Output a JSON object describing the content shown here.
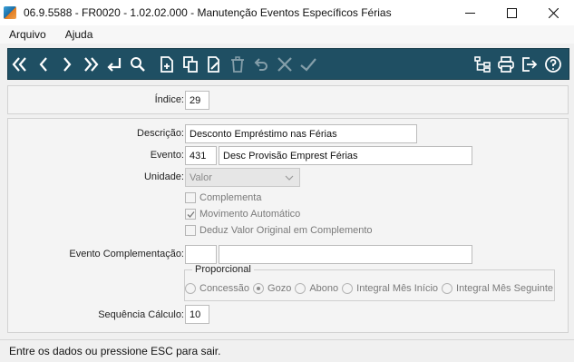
{
  "window": {
    "title": "06.9.5588 - FR0020 - 1.02.02.000 - Manutenção Eventos Específicos Férias"
  },
  "menu": {
    "items": [
      "Arquivo",
      "Ajuda"
    ]
  },
  "toolbar": {
    "icon_color": "#ffffff",
    "background": "#1f4f63",
    "buttons": [
      "first-record",
      "previous-record",
      "next-record",
      "last-record",
      "return",
      "search",
      "new-record",
      "copy-record",
      "edit-record",
      "delete-record",
      "undo",
      "cancel",
      "confirm",
      "tree",
      "print",
      "exit",
      "help"
    ]
  },
  "form": {
    "indice": {
      "label": "Índice:",
      "value": "29"
    },
    "descricao": {
      "label": "Descrição:",
      "value": "Desconto Empréstimo nas Férias"
    },
    "evento": {
      "label": "Evento:",
      "code": "431",
      "description": "Desc Provisão Emprest Férias"
    },
    "unidade": {
      "label": "Unidade:",
      "value": "Valor"
    },
    "checks": [
      {
        "label": "Complementa",
        "checked": false
      },
      {
        "label": "Movimento Automático",
        "checked": true
      },
      {
        "label": "Deduz Valor Original em Complemento",
        "checked": false
      }
    ],
    "evento_complementacao": {
      "label": "Evento Complementação:",
      "code": "",
      "description": ""
    },
    "proporcional": {
      "label": "Proporcional",
      "options": [
        {
          "label": "Concessão",
          "selected": false
        },
        {
          "label": "Gozo",
          "selected": true
        },
        {
          "label": "Abono",
          "selected": false
        },
        {
          "label": "Integral Mês Início",
          "selected": false
        },
        {
          "label": "Integral Mês Seguinte",
          "selected": false
        }
      ]
    },
    "sequencia": {
      "label": "Sequência Cálculo:",
      "value": "10"
    }
  },
  "status": {
    "message": "Entre os dados ou pressione ESC para sair."
  }
}
